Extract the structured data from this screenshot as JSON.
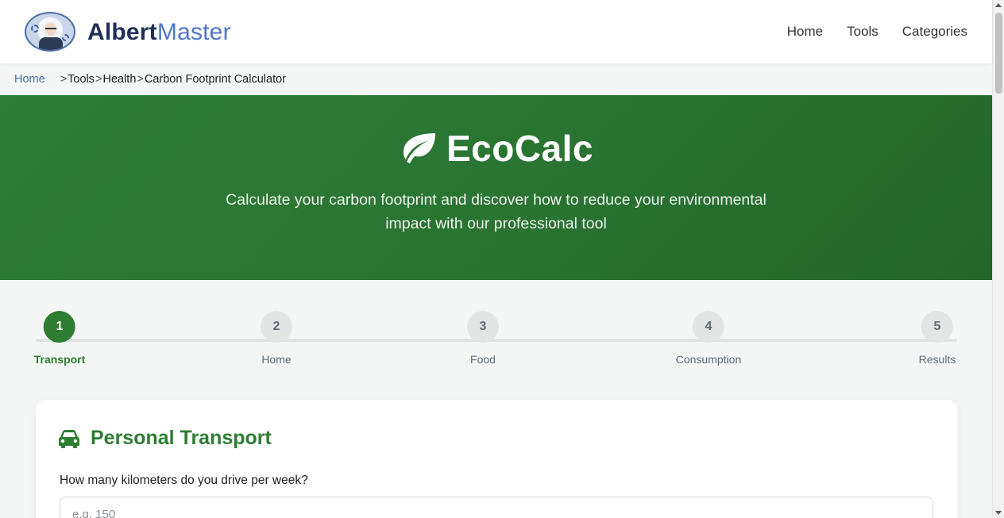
{
  "header": {
    "brand_part1": "Albert",
    "brand_part2": "Master",
    "nav": [
      {
        "label": "Home"
      },
      {
        "label": "Tools"
      },
      {
        "label": "Categories"
      }
    ]
  },
  "breadcrumb": {
    "home": "Home",
    "items": [
      "Tools",
      "Health",
      "Carbon Footprint Calculator"
    ],
    "separator": ">"
  },
  "hero": {
    "icon": "leaf-icon",
    "title": "EcoCalc",
    "subtitle": "Calculate your carbon footprint and discover how to reduce your environmental impact with our professional tool"
  },
  "stepper": {
    "steps": [
      {
        "number": "1",
        "label": "Transport"
      },
      {
        "number": "2",
        "label": "Home"
      },
      {
        "number": "3",
        "label": "Food"
      },
      {
        "number": "4",
        "label": "Consumption"
      },
      {
        "number": "5",
        "label": "Results"
      }
    ],
    "active_step": "1"
  },
  "card": {
    "icon": "car-icon",
    "title": "Personal Transport",
    "question": "How many kilometers do you drive per week?",
    "input_placeholder": "e.g. 150",
    "input_value": ""
  },
  "colors": {
    "primary_green": "#2e7d32",
    "brand_dark": "#1f2f57",
    "brand_blue": "#5076c9",
    "link_blue": "#4a6fa8"
  }
}
